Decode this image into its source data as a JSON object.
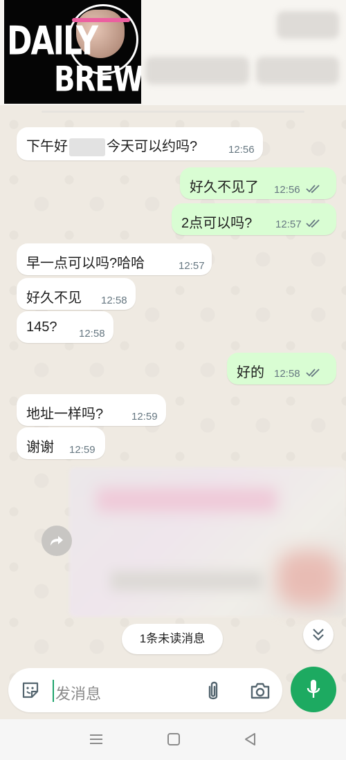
{
  "header": {
    "logo_line1": "DAILY",
    "logo_line2": "BREW"
  },
  "messages": [
    {
      "dir": "in",
      "before": "下午好",
      "after": "今天可以约吗?",
      "time": "12:56"
    },
    {
      "dir": "out",
      "text": "好久不见了",
      "time": "12:56",
      "status": "read"
    },
    {
      "dir": "out",
      "text": "2点可以吗?",
      "time": "12:57",
      "status": "read"
    },
    {
      "dir": "in",
      "text": "早一点可以吗?哈哈",
      "time": "12:57"
    },
    {
      "dir": "in",
      "text": "好久不见",
      "time": "12:58"
    },
    {
      "dir": "in",
      "text": "145?",
      "time": "12:58"
    },
    {
      "dir": "out",
      "text": "好的",
      "time": "12:58",
      "status": "read"
    },
    {
      "dir": "in",
      "text": "地址一样吗?",
      "time": "12:59"
    },
    {
      "dir": "in",
      "text": "谢谢",
      "time": "12:59"
    }
  ],
  "unread_banner": "1条未读消息",
  "composer": {
    "placeholder": "发消息"
  },
  "icons": {
    "emoji": "sticker-icon",
    "attach": "paperclip-icon",
    "camera": "camera-icon",
    "mic": "microphone-icon",
    "forward": "forward-icon",
    "scroll": "double-chevron-down-icon"
  },
  "colors": {
    "incoming": "#ffffff",
    "outgoing": "#d9fdd3",
    "accent": "#1daa61",
    "read_tick": "#667781"
  }
}
